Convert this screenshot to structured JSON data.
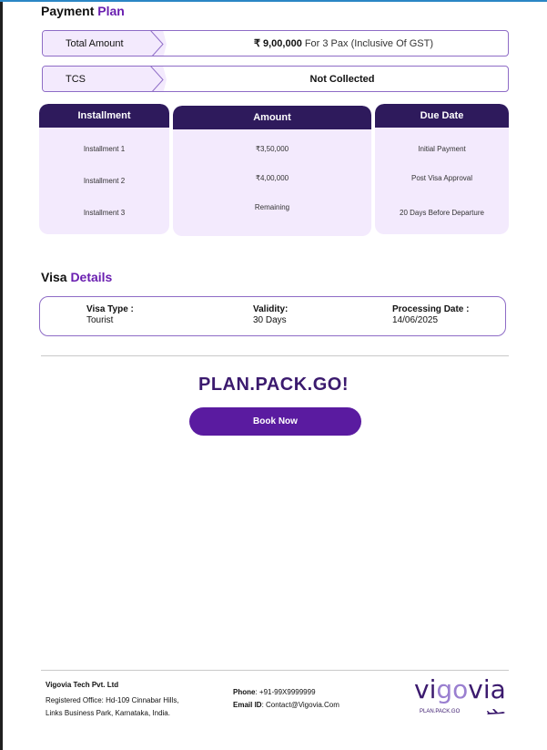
{
  "payment_plan": {
    "title_main": "Payment",
    "title_accent": "Plan",
    "total_amount_label": "Total Amount",
    "total_amount_value": "₹ 9,00,000",
    "total_amount_note": "For 3 Pax (Inclusive Of GST)",
    "tcs_label": "TCS",
    "tcs_value": "Not Collected",
    "columns": {
      "installment": "Installment",
      "amount": "Amount",
      "due_date": "Due Date"
    },
    "rows": [
      {
        "installment": "Installment 1",
        "amount": "₹3,50,000",
        "due": "Initial Payment"
      },
      {
        "installment": "Installment 2",
        "amount": "₹4,00,000",
        "due": "Post Visa Approval"
      },
      {
        "installment": "Installment 3",
        "amount": "Remaining",
        "due": "20 Days Before Departure"
      }
    ]
  },
  "visa": {
    "title_main": "Visa",
    "title_accent": "Details",
    "type_label": "Visa Type :",
    "type_value": "Tourist",
    "validity_label": "Validity:",
    "validity_value": "30 Days",
    "processing_label": "Processing Date :",
    "processing_value": "14/06/2025"
  },
  "cta": {
    "tagline": "PLAN.PACK.GO!",
    "button": "Book Now"
  },
  "footer": {
    "company": "Vigovia Tech Pvt. Ltd",
    "address_line1": "Registered Office: Hd-109 Cinnabar Hills,",
    "address_line2": "Links Business Park,   Karnataka, India.",
    "phone_label": "Phone",
    "phone_value": ": +91-99X9999999",
    "email_label": "Email ID",
    "email_value": ": Contact@Vigovia.Com",
    "logo_pre": "vi",
    "logo_go": "go",
    "logo_post": "via",
    "logo_sub": "PLAN.PACK.GO"
  },
  "colors": {
    "accent": "#6a1fb0",
    "header_dark": "#2e1a5c",
    "panel_bg": "#f3eafd",
    "button": "#5a1ba0"
  },
  "icons": [
    "plane-icon",
    "arrow-chevron-icon"
  ]
}
